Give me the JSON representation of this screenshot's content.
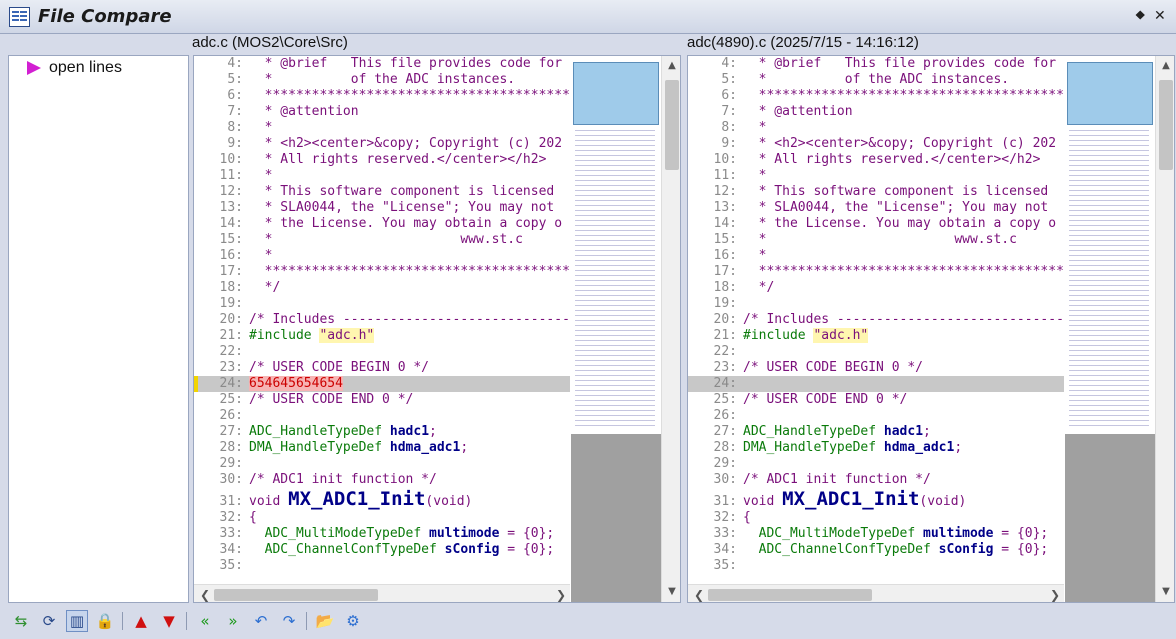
{
  "window": {
    "title": "File Compare"
  },
  "left": {
    "header": "adc.c (MOS2\\Core\\Src)",
    "lines": [
      {
        "n": "4:",
        "t": "  * @brief   This file provides code for"
      },
      {
        "n": "5:",
        "t": "  *          of the ADC instances."
      },
      {
        "n": "6:",
        "t": "  ****************************************"
      },
      {
        "n": "7:",
        "t": "  * @attention"
      },
      {
        "n": "8:",
        "t": "  *"
      },
      {
        "n": "9:",
        "t": "  * <h2><center>&copy; Copyright (c) 202"
      },
      {
        "n": "10:",
        "t": "  * All rights reserved.</center></h2>"
      },
      {
        "n": "11:",
        "t": "  *"
      },
      {
        "n": "12:",
        "t": "  * This software component is licensed"
      },
      {
        "n": "13:",
        "t": "  * SLA0044, the \"License\"; You may not"
      },
      {
        "n": "14:",
        "t": "  * the License. You may obtain a copy o"
      },
      {
        "n": "15:",
        "t": "  *                        www.st.c"
      },
      {
        "n": "16:",
        "t": "  *"
      },
      {
        "n": "17:",
        "t": "  ****************************************"
      },
      {
        "n": "18:",
        "t": "  */"
      },
      {
        "n": "19:",
        "t": ""
      },
      {
        "n": "20:",
        "t": "/* Includes ------------------------------"
      },
      {
        "n": "21:",
        "a": "#include ",
        "b": "\"adc.h\""
      },
      {
        "n": "22:",
        "t": ""
      },
      {
        "n": "23:",
        "t": "/* USER CODE BEGIN 0 */"
      },
      {
        "n": "24:",
        "d": "654645654654"
      },
      {
        "n": "25:",
        "t": "/* USER CODE END 0 */"
      },
      {
        "n": "26:",
        "t": ""
      },
      {
        "n": "27:",
        "ty": "ADC_HandleTypeDef ",
        "v": "hadc1",
        "p": ";"
      },
      {
        "n": "28:",
        "ty": "DMA_HandleTypeDef ",
        "v": "hdma_adc1",
        "p": ";"
      },
      {
        "n": "29:",
        "t": ""
      },
      {
        "n": "30:",
        "t": "/* ADC1 init function */"
      },
      {
        "n": "31:",
        "k": "void ",
        "f": "MX_ADC1_Init",
        "k2": "(void)"
      },
      {
        "n": "32:",
        "t": "{"
      },
      {
        "n": "33:",
        "ty": "  ADC_MultiModeTypeDef ",
        "v": "multimode",
        "p": " = {0};"
      },
      {
        "n": "34:",
        "ty": "  ADC_ChannelConfTypeDef ",
        "v": "sConfig",
        "p": " = {0};"
      },
      {
        "n": "35:",
        "t": ""
      }
    ]
  },
  "right": {
    "header": "adc(4890).c (2025/7/15 - 14:16:12)",
    "lines": [
      {
        "n": "4:",
        "t": "  * @brief   This file provides code for"
      },
      {
        "n": "5:",
        "t": "  *          of the ADC instances."
      },
      {
        "n": "6:",
        "t": "  ****************************************"
      },
      {
        "n": "7:",
        "t": "  * @attention"
      },
      {
        "n": "8:",
        "t": "  *"
      },
      {
        "n": "9:",
        "t": "  * <h2><center>&copy; Copyright (c) 202"
      },
      {
        "n": "10:",
        "t": "  * All rights reserved.</center></h2>"
      },
      {
        "n": "11:",
        "t": "  *"
      },
      {
        "n": "12:",
        "t": "  * This software component is licensed"
      },
      {
        "n": "13:",
        "t": "  * SLA0044, the \"License\"; You may not"
      },
      {
        "n": "14:",
        "t": "  * the License. You may obtain a copy o"
      },
      {
        "n": "15:",
        "t": "  *                        www.st.c"
      },
      {
        "n": "16:",
        "t": "  *"
      },
      {
        "n": "17:",
        "t": "  ****************************************"
      },
      {
        "n": "18:",
        "t": "  */"
      },
      {
        "n": "19:",
        "t": ""
      },
      {
        "n": "20:",
        "t": "/* Includes ------------------------------"
      },
      {
        "n": "21:",
        "a": "#include ",
        "b": "\"adc.h\""
      },
      {
        "n": "22:",
        "t": ""
      },
      {
        "n": "23:",
        "t": "/* USER CODE BEGIN 0 */"
      },
      {
        "n": "24:",
        "e": true
      },
      {
        "n": "25:",
        "t": "/* USER CODE END 0 */"
      },
      {
        "n": "26:",
        "t": ""
      },
      {
        "n": "27:",
        "ty": "ADC_HandleTypeDef ",
        "v": "hadc1",
        "p": ";"
      },
      {
        "n": "28:",
        "ty": "DMA_HandleTypeDef ",
        "v": "hdma_adc1",
        "p": ";"
      },
      {
        "n": "29:",
        "t": ""
      },
      {
        "n": "30:",
        "t": "/* ADC1 init function */"
      },
      {
        "n": "31:",
        "k": "void ",
        "f": "MX_ADC1_Init",
        "k2": "(void)"
      },
      {
        "n": "32:",
        "t": "{"
      },
      {
        "n": "33:",
        "ty": "  ADC_MultiModeTypeDef ",
        "v": "multimode",
        "p": " = {0};"
      },
      {
        "n": "34:",
        "ty": "  ADC_ChannelConfTypeDef ",
        "v": "sConfig",
        "p": " = {0};"
      },
      {
        "n": "35:",
        "t": ""
      }
    ]
  },
  "nav": {
    "items": [
      {
        "label": "open lines"
      }
    ]
  },
  "toolbar": {
    "buttons": [
      {
        "name": "merge-icon",
        "glyph": "⇆",
        "color": "#2f8f2f"
      },
      {
        "name": "sync-scroll-icon",
        "glyph": "⟳",
        "color": "#2a4a8a"
      },
      {
        "name": "side-by-side-icon",
        "glyph": "▥",
        "color": "#2a4a8a",
        "pressed": true
      },
      {
        "name": "lock-icon",
        "glyph": "🔒",
        "color": "#666"
      },
      {
        "name": "prev-diff-icon",
        "glyph": "▲",
        "color": "#d01010"
      },
      {
        "name": "next-diff-icon",
        "glyph": "▼",
        "color": "#d01010"
      },
      {
        "name": "copy-to-left-icon",
        "glyph": "«",
        "color": "#1e9a1e"
      },
      {
        "name": "copy-to-right-icon",
        "glyph": "»",
        "color": "#1e9a1e"
      },
      {
        "name": "undo-icon",
        "glyph": "↶",
        "color": "#2d6fd1"
      },
      {
        "name": "redo-icon",
        "glyph": "↷",
        "color": "#2d6fd1"
      },
      {
        "name": "open-folder-icon",
        "glyph": "📂",
        "color": "#c08a1a"
      },
      {
        "name": "settings-gear-icon",
        "glyph": "⚙",
        "color": "#2d6fd1"
      }
    ]
  },
  "colors": {
    "diff_line_bg": "#c8c8c8",
    "diff_text_bg": "#f6b4b4",
    "diff_marker": "#f2d400",
    "overview_selection": "#9fcbea"
  }
}
